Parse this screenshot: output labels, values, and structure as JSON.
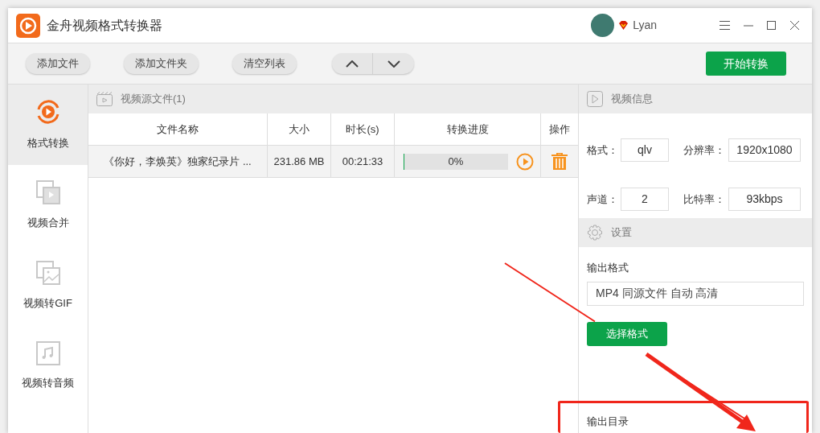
{
  "window": {
    "title": "金舟视频格式转换器",
    "user": "Lyan"
  },
  "toolbar": {
    "buttons": [
      "添加文件",
      "添加文件夹",
      "清空列表"
    ],
    "start_button": "开始转换"
  },
  "sidebar": {
    "items": [
      {
        "label": "格式转换",
        "selected": true
      },
      {
        "label": "视频合并",
        "selected": false
      },
      {
        "label": "视频转GIF",
        "selected": false
      },
      {
        "label": "视频转音频",
        "selected": false
      }
    ]
  },
  "file_list": {
    "title": "视频源文件(1)",
    "columns": [
      "文件名称",
      "大小",
      "时长(s)",
      "转换进度",
      "操作"
    ],
    "rows": [
      {
        "name": "《你好，李焕英》独家纪录片 ...",
        "size": "231.86 MB",
        "duration": "00:21:33",
        "progress": "0%",
        "level": 0
      }
    ]
  },
  "video_info": {
    "title": "视频信息",
    "format_label": "格式：",
    "format": "qlv",
    "resolution_label": "分辨率：",
    "resolution": "1920x1080",
    "channels_label": "声道：",
    "channels": "2",
    "bitrate_label": "比特率：",
    "bitrate": "93kbps"
  },
  "settings": {
    "title": "设置",
    "output_format_label": "输出格式",
    "output_format": "MP4 同源文件 自动 高清",
    "choose_format_button": "选择格式",
    "output_dir_label": "输出目录"
  }
}
